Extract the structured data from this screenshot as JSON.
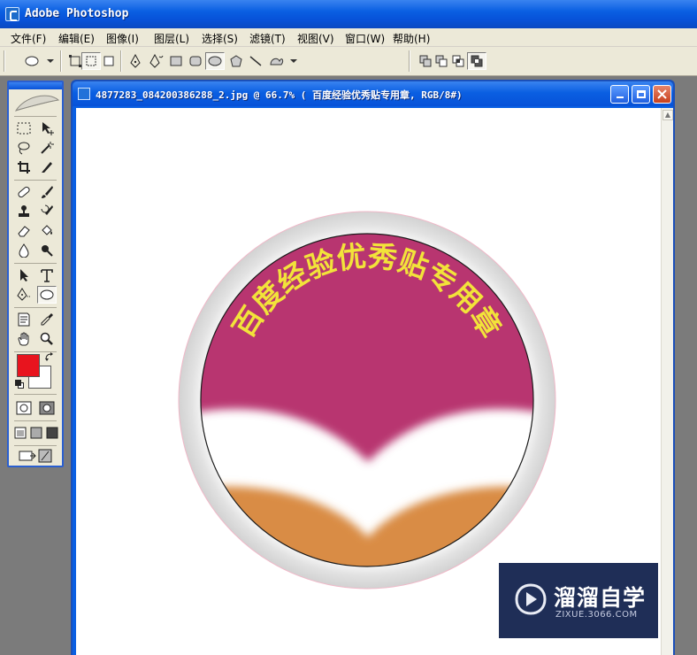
{
  "app": {
    "title": "Adobe Photoshop"
  },
  "menu": [
    {
      "label": "文件(F)"
    },
    {
      "label": "编辑(E)"
    },
    {
      "label": "图像(I)"
    },
    {
      "label": "图层(L)"
    },
    {
      "label": "选择(S)"
    },
    {
      "label": "滤镜(T)"
    },
    {
      "label": "视图(V)"
    },
    {
      "label": "窗口(W)"
    },
    {
      "label": "帮助(H)"
    }
  ],
  "document": {
    "title": "4877283_084200386288_2.jpg @ 66.7% ( 百度经验优秀贴专用章, RGB/8#)",
    "seal_text": "百度经验优秀贴专用章"
  },
  "colors": {
    "foreground": "#e8141e",
    "background": "#ffffff",
    "seal_top": "#b8356f",
    "seal_bottom": "#d98c45",
    "seal_text": "#f2e33a"
  },
  "watermark": {
    "main": "溜溜自学",
    "sub": "ZIXUE.3066.COM"
  }
}
